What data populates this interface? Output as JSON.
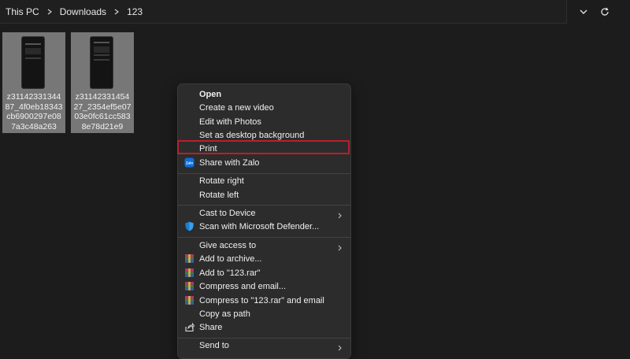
{
  "breadcrumb": [
    "This PC",
    "Downloads",
    "123"
  ],
  "files": [
    {
      "name": "z3114233134487_4f0eb18343cb6900297e087a3c48a263"
    },
    {
      "name": "z3114233145427_2354ef5e0703e0fc61cc5838e78d21e9"
    }
  ],
  "context_menu": {
    "open": "Open",
    "create_video": "Create a new video",
    "edit_photos": "Edit with Photos",
    "set_background": "Set as desktop background",
    "print": "Print",
    "share_zalo": "Share with Zalo",
    "rotate_right": "Rotate right",
    "rotate_left": "Rotate left",
    "cast": "Cast to Device",
    "scan_defender": "Scan with Microsoft Defender...",
    "give_access": "Give access to",
    "add_archive": "Add to archive...",
    "add_rar": "Add to \"123.rar\"",
    "compress_email": "Compress and email...",
    "compress_rar_email": "Compress to \"123.rar\" and email",
    "copy_path": "Copy as path",
    "share": "Share",
    "send_to": "Send to"
  },
  "icons": {
    "zalo": "zalo-icon",
    "defender": "shield-icon",
    "winrar": "winrar-icon",
    "share": "share-icon",
    "refresh": "refresh-icon",
    "dropdown": "chevron-down-icon"
  },
  "colors": {
    "highlight_border": "#b8202c",
    "menu_bg": "#2c2c2c",
    "selected_tile": "#777777"
  }
}
